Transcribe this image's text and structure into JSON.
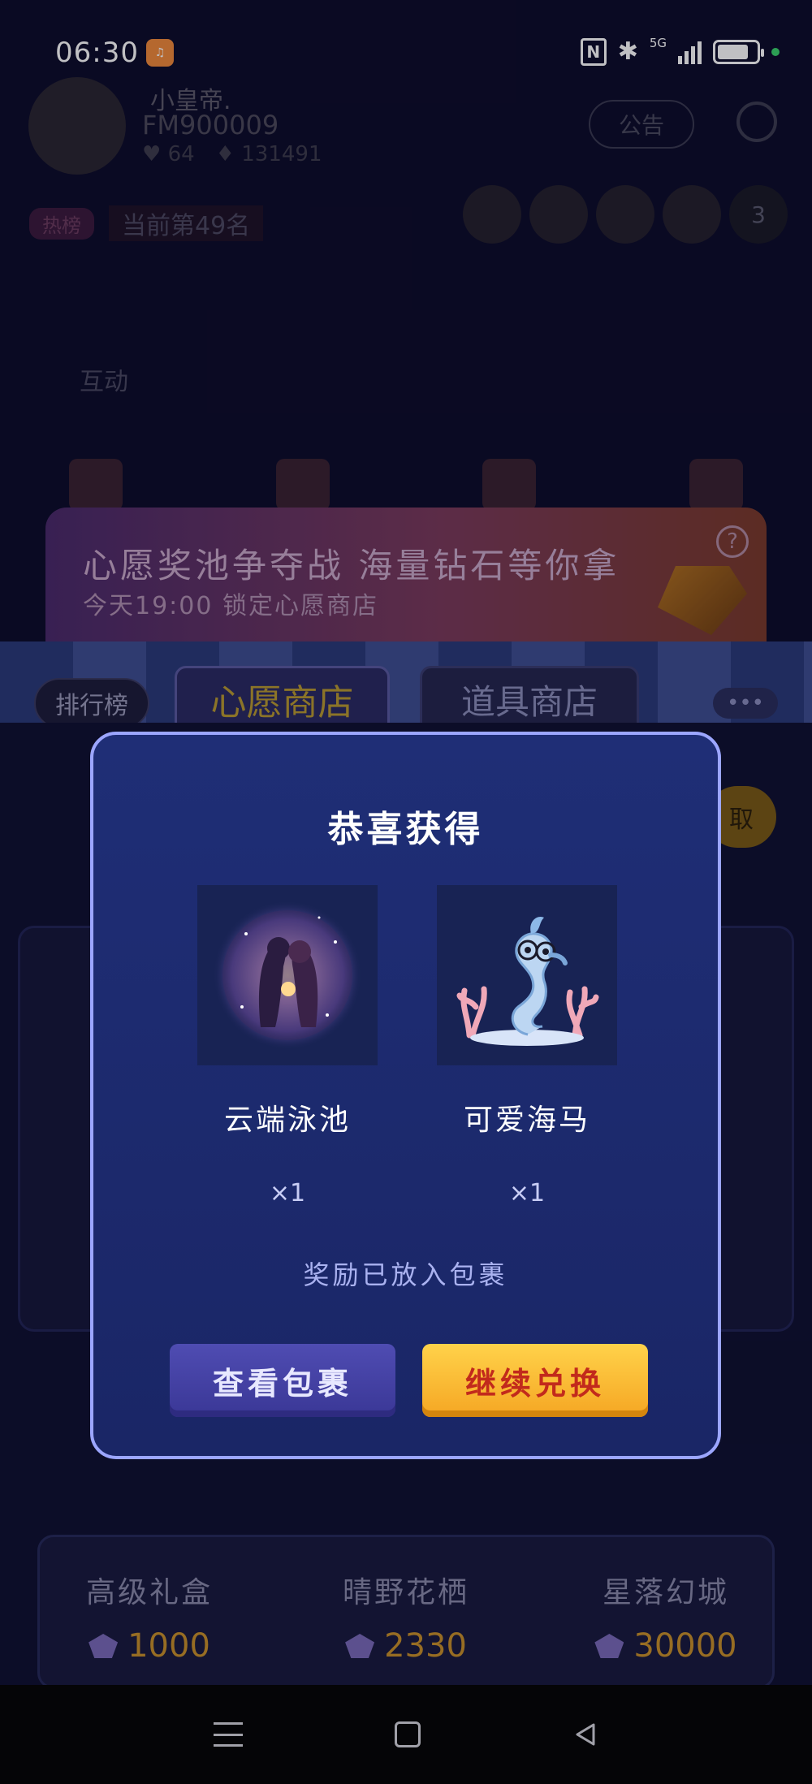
{
  "status_bar": {
    "time": "06:30",
    "network": "5G",
    "icons": [
      "app-icon",
      "nfc-icon",
      "bluetooth-icon",
      "signal-icon",
      "battery-icon"
    ]
  },
  "profile": {
    "name": "小皇帝.",
    "id": "FM900009",
    "stat_one": "64",
    "stat_two": "131491",
    "notice_label": "公告"
  },
  "ranking": {
    "badge": "热榜",
    "text": "当前第49名",
    "viewer_count": "3"
  },
  "section": {
    "label": "互动"
  },
  "banner": {
    "title": "心愿奖池争夺战 海量钻石等你拿",
    "subtitle": "今天19:00 锁定心愿商店",
    "help": "?"
  },
  "tabs": {
    "rank": "排行榜",
    "wish_shop": "心愿商店",
    "prop_shop": "道具商店",
    "more": "•••"
  },
  "shop": {
    "get_button": "取",
    "products": [
      {
        "name": "高级礼盒",
        "price": "1000"
      },
      {
        "name": "晴野花栖",
        "price": "2330"
      },
      {
        "name": "星落幻城",
        "price": "30000"
      }
    ]
  },
  "modal": {
    "title": "恭喜获得",
    "rewards": [
      {
        "name": "云端泳池",
        "qty": "×1"
      },
      {
        "name": "可爱海马",
        "qty": "×1"
      }
    ],
    "note": "奖励已放入包裹",
    "view_button": "查看包裹",
    "continue_button": "继续兑换"
  },
  "colors": {
    "modal_border": "#9ca6ff",
    "modal_bg": "#1f2e76",
    "continue_button": "#f5a623",
    "continue_text": "#c22a1c",
    "view_button": "#4f4cb2"
  }
}
